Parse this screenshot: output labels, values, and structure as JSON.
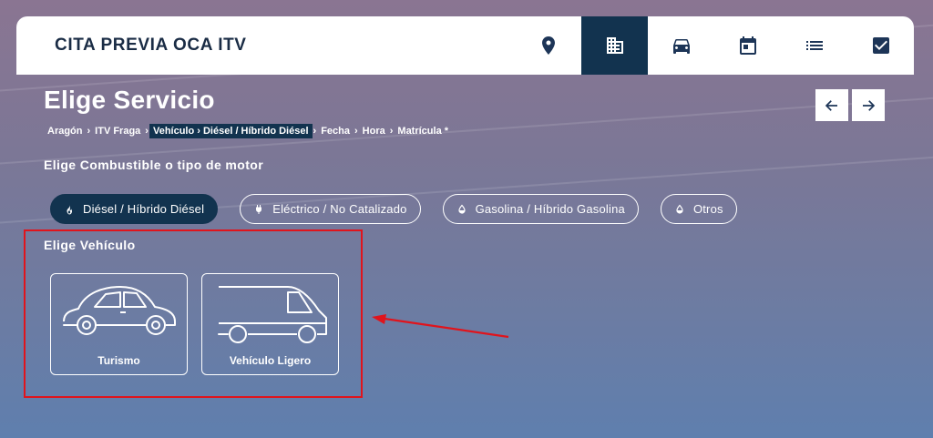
{
  "header": {
    "brand": "CITA PREVIA OCA ITV",
    "nav": [
      {
        "icon": "location-pin-icon",
        "active": false
      },
      {
        "icon": "building-icon",
        "active": true
      },
      {
        "icon": "car-icon",
        "active": false
      },
      {
        "icon": "calendar-icon",
        "active": false
      },
      {
        "icon": "list-icon",
        "active": false
      },
      {
        "icon": "checkbox-icon",
        "active": false
      }
    ]
  },
  "page": {
    "title": "Elige Servicio",
    "breadcrumb": [
      "Aragón",
      "ITV Fraga",
      "Vehículo › Diésel / Híbrido Diésel",
      "Fecha",
      "Hora",
      "Matrícula *"
    ],
    "breadcrumb_active_index": 2,
    "fuel_label": "Elige Combustible o tipo de motor",
    "fuel_options": [
      {
        "label": "Diésel / Híbrido Diésel",
        "icon": "flame-icon",
        "selected": true
      },
      {
        "label": "Eléctrico / No Catalizado",
        "icon": "plug-icon",
        "selected": false
      },
      {
        "label": "Gasolina / Híbrido Gasolina",
        "icon": "drop-icon",
        "selected": false
      },
      {
        "label": "Otros",
        "icon": "drop-icon",
        "selected": false
      }
    ],
    "vehicle_label": "Elige Vehículo",
    "vehicles": [
      {
        "label": "Turismo",
        "icon": "beetle-car-icon"
      },
      {
        "label": "Vehículo Ligero",
        "icon": "van-icon"
      }
    ]
  },
  "colors": {
    "accent": "#12334f",
    "annotation": "#e0141c"
  }
}
